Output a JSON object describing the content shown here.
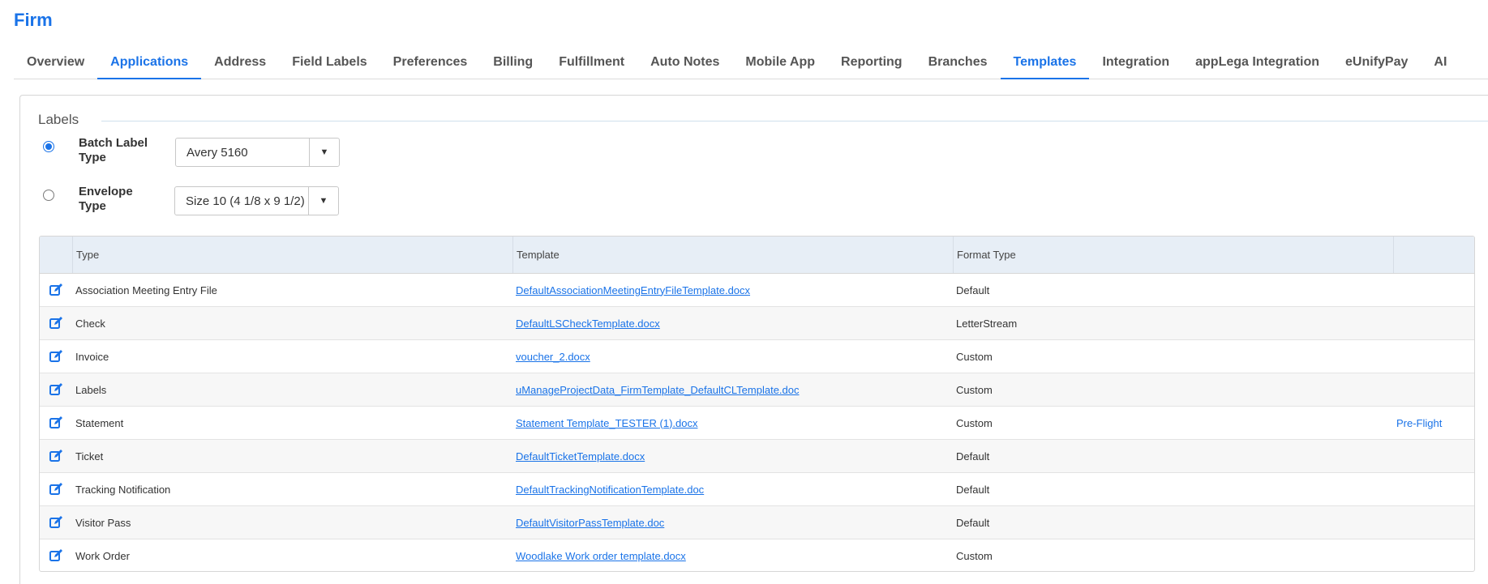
{
  "page": {
    "title": "Firm"
  },
  "tabs": [
    {
      "label": "Overview",
      "active": false
    },
    {
      "label": "Applications",
      "active": true
    },
    {
      "label": "Address",
      "active": false
    },
    {
      "label": "Field Labels",
      "active": false
    },
    {
      "label": "Preferences",
      "active": false
    },
    {
      "label": "Billing",
      "active": false
    },
    {
      "label": "Fulfillment",
      "active": false
    },
    {
      "label": "Auto Notes",
      "active": false
    },
    {
      "label": "Mobile App",
      "active": false
    },
    {
      "label": "Reporting",
      "active": false
    },
    {
      "label": "Branches",
      "active": false
    },
    {
      "label": "Templates",
      "active": true
    },
    {
      "label": "Integration",
      "active": false
    },
    {
      "label": "appLega Integration",
      "active": false
    },
    {
      "label": "eUnifyPay",
      "active": false
    },
    {
      "label": "AI",
      "active": false
    }
  ],
  "labels_section": {
    "legend": "Labels",
    "batch": {
      "label": "Batch Label Type",
      "selected": true,
      "value": "Avery 5160"
    },
    "envelope": {
      "label": "Envelope Type",
      "selected": false,
      "value": "Size 10 (4 1/8 x 9 1/2)"
    }
  },
  "grid": {
    "columns": [
      "",
      "Type",
      "Template",
      "Format Type",
      ""
    ],
    "rows": [
      {
        "type": "Association Meeting Entry File",
        "template": "DefaultAssociationMeetingEntryFileTemplate.docx",
        "format": "Default",
        "action": ""
      },
      {
        "type": "Check",
        "template": "DefaultLSCheckTemplate.docx",
        "format": "LetterStream",
        "action": ""
      },
      {
        "type": "Invoice",
        "template": "voucher_2.docx",
        "format": "Custom",
        "action": ""
      },
      {
        "type": "Labels",
        "template": "uManageProjectData_FirmTemplate_DefaultCLTemplate.doc",
        "format": "Custom",
        "action": ""
      },
      {
        "type": "Statement",
        "template": "Statement Template_TESTER (1).docx",
        "format": "Custom",
        "action": "Pre-Flight"
      },
      {
        "type": "Ticket",
        "template": "DefaultTicketTemplate.docx",
        "format": "Default",
        "action": ""
      },
      {
        "type": "Tracking Notification",
        "template": "DefaultTrackingNotificationTemplate.doc",
        "format": "Default",
        "action": ""
      },
      {
        "type": "Visitor Pass",
        "template": "DefaultVisitorPassTemplate.doc",
        "format": "Default",
        "action": ""
      },
      {
        "type": "Work Order",
        "template": "Woodlake Work order template.docx",
        "format": "Custom",
        "action": ""
      }
    ]
  },
  "colors": {
    "accent": "#1a73e8",
    "arrow": "#1aa489",
    "header_bg": "#e7eef6"
  },
  "icons": {
    "row_edit": "edit-icon",
    "select_toggle": "caret-down-icon",
    "annotation": "arrow-icon"
  }
}
